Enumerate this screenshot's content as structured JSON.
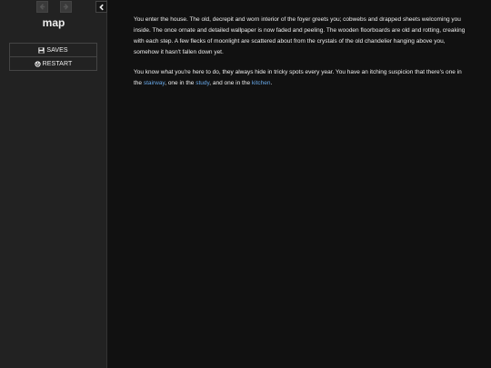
{
  "sidebar": {
    "title": "map",
    "menu": {
      "saves_label": "SAVES",
      "restart_label": "RESTART"
    }
  },
  "passage": {
    "paragraph1": "You enter the house. The old, decrepit and worn interior of the foyer greets you; cobwebs and drapped sheets welcoming you inside. The once ornate and detailed wallpaper is now faded and peeling. The wooden floorboards are old and rotting, creaking with each step. A few flecks of moonlight are scattered about from the crystals of the old chandelier hanging above you, somehow it hasn't fallen down yet.",
    "paragraph2": {
      "intro": "You know what you're here to do, they always hide in tricky spots every year. You have an itching suspicion that there's one in the ",
      "link1": "stairway",
      "sep1": ", one in the ",
      "link2": "study",
      "sep2": ", and one in the ",
      "link3": "kitchen",
      "end": "."
    }
  },
  "colors": {
    "background": "#111111",
    "sidebar": "#222222",
    "text": "#eeeeee",
    "link": "#68a8e8"
  },
  "icons": {
    "back": "arrow-left-icon",
    "forward": "arrow-right-icon",
    "toggle": "chevron-left-icon",
    "saves": "save-icon",
    "restart": "power-icon"
  }
}
